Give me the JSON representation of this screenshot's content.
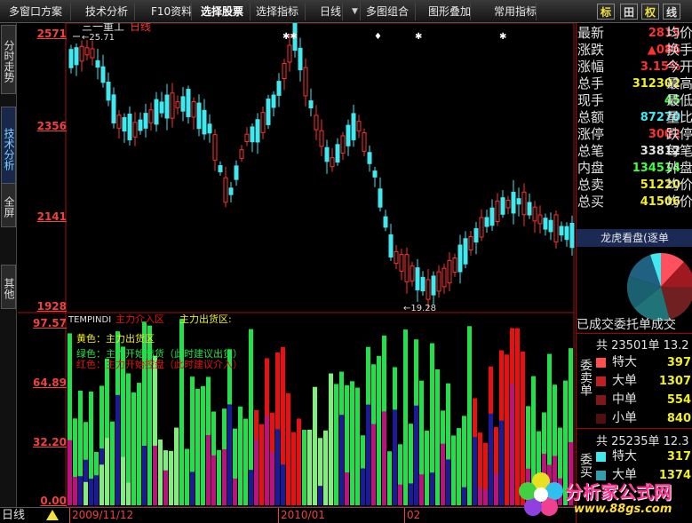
{
  "toolbar": {
    "items": [
      "多窗口方案",
      "技术分析",
      "F10资料",
      "选择股票",
      "选择指标",
      "日线",
      "多图组合",
      "图形叠加",
      "常用指标"
    ],
    "right_buttons": [
      "标",
      "田",
      "权",
      "线"
    ],
    "marker": "▼"
  },
  "left_tabs": [
    "分时走势",
    "技术分析",
    "全屏",
    "其他"
  ],
  "chart": {
    "stock_name": "三一重工",
    "period": "日线",
    "high_label": "25.71",
    "low_label": "19.28",
    "y_ticks_top": [
      "2571",
      "2356",
      "2141",
      "1928"
    ],
    "indicator_name": "TEMPINDI",
    "legend_inflow": "主力介入区",
    "legend_outflow": "主力出货区:",
    "note_yellow": "黄色：主力出货区",
    "note_green": "绿色：主力开始出货（此时建议出货）",
    "note_red": "红色：主力开始控盘（此时建议介入）",
    "y_ticks_bottom": [
      "97.57",
      "64.89",
      "32.20",
      "0.00"
    ],
    "x_labels": [
      "2009/11/12",
      "2010/01",
      "02"
    ],
    "period_label": "日线",
    "colors": {
      "up": "#ff3030",
      "down": "#40e8f0",
      "green": "#22e04a",
      "lightgreen": "#7ef07a",
      "yellow": "#e8f020",
      "red": "#e81010",
      "navy": "#1a1a9a",
      "purple": "#c01080"
    }
  },
  "quote": {
    "rows": [
      {
        "l": "最新",
        "v": "2815",
        "vc": "#ff3030",
        "r": "均价"
      },
      {
        "l": "涨跌",
        "v": "▲086",
        "vc": "#ff3030",
        "r": "换手"
      },
      {
        "l": "涨幅",
        "v": "3.15%",
        "vc": "#ff3030",
        "r": "今开"
      },
      {
        "l": "总手",
        "v": "312302",
        "vc": "#f0f020",
        "r": "最高"
      },
      {
        "l": "现手",
        "v": "45",
        "vc": "#40ff40",
        "r": "最低"
      },
      {
        "l": "总额",
        "v": "87270",
        "vc": "#40e8f0",
        "r": "量比"
      },
      {
        "l": "涨停",
        "v": "3002",
        "vc": "#ff3030",
        "r": "跌停"
      },
      {
        "l": "总笔",
        "v": "33812",
        "vc": "#e0e0e0",
        "r": "每笔"
      },
      {
        "l": "内盘",
        "v": "134514",
        "vc": "#40ff40",
        "r": "外盘"
      },
      {
        "l": "总卖",
        "v": "51220",
        "vc": "#f0f020",
        "r": "均价"
      },
      {
        "l": "总买",
        "v": "41506",
        "vc": "#f0f020",
        "r": "均价"
      }
    ],
    "dragon_title": "龙虎看盘(逐单",
    "trade_header": "已成交委托单成交",
    "sell_label": "委卖单",
    "sell_total": "共 23501单 13.2",
    "sell_rows": [
      {
        "name": "特大",
        "value": "397",
        "color": "#ff5050"
      },
      {
        "name": "大单",
        "value": "1307",
        "color": "#c02020"
      },
      {
        "name": "中单",
        "value": "554",
        "color": "#801818"
      },
      {
        "name": "小单",
        "value": "840",
        "color": "#501010"
      }
    ],
    "buy_label": "委买",
    "buy_total": "共 25235单 12.3",
    "buy_rows": [
      {
        "name": "特大",
        "value": "317",
        "color": "#40e8f0"
      },
      {
        "name": "大单",
        "value": "1374",
        "color": "#30a0b0"
      }
    ]
  },
  "watermark": {
    "cn": "分析家公式网",
    "url": "www.88gs.com"
  }
}
